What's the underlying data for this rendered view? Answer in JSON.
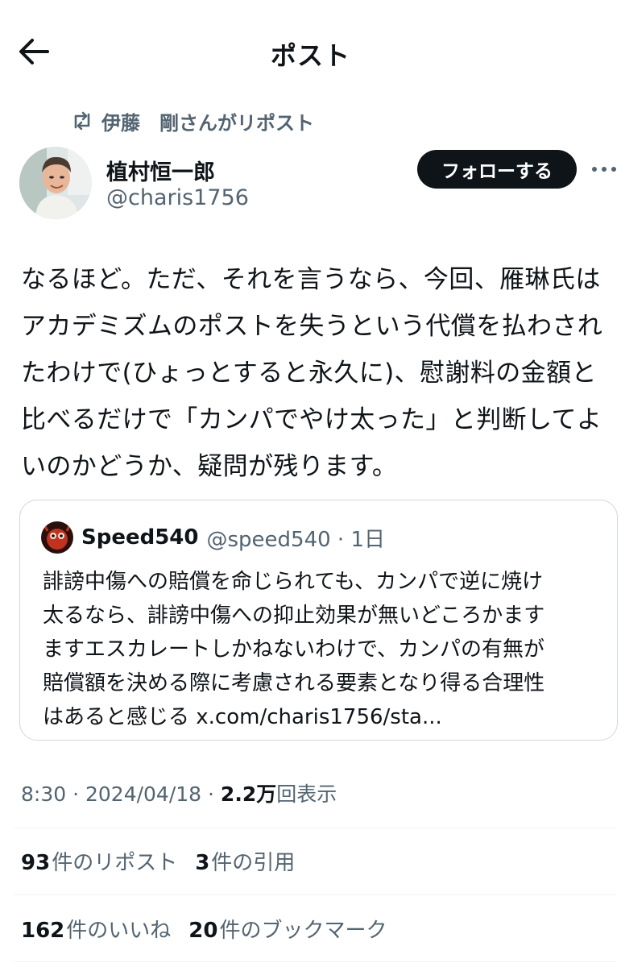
{
  "header": {
    "title": "ポスト",
    "back_icon": "arrow-left-icon"
  },
  "repost": {
    "icon": "repost-icon",
    "text": "伊藤　剛さんがリポスト"
  },
  "author": {
    "name": "植村恒一郎",
    "handle": "@charis1756",
    "follow_label": "フォローする",
    "more_icon": "more-icon"
  },
  "post": {
    "text": "なるほど。ただ、それを言うなら、今回、雁琳氏は\nアカデミズムのポストを失うという代償を払わされ\nたわけで(ひょっとすると永久に)、慰謝料の金額と\n比べるだけで「カンパでやけ太った」と判断してよ\nいのかどうか、疑問が残ります。"
  },
  "quote": {
    "name": "Speed540",
    "handle_time": "@speed540 · 1日",
    "text": "誹謗中傷への賠償を命じられても、カンパで逆に焼け\n太るなら、誹謗中傷への抑止効果が無いどころかます\nますエスカレートしかねないわけで、カンパの有無が\n賠償額を決める際に考慮される要素となり得る合理性\nはあると感じる x.com/charis1756/sta..."
  },
  "meta": {
    "time_date": "8:30 · 2024/04/18 · ",
    "views_count": "2.2万",
    "views_label": "回表示"
  },
  "stats": {
    "reposts_count": "93",
    "reposts_label": "件のリポスト",
    "quotes_count": "3",
    "quotes_label": "件の引用",
    "likes_count": "162",
    "likes_label": "件のいいね",
    "bookmarks_count": "20",
    "bookmarks_label": "件のブックマーク"
  },
  "colors": {
    "text_primary": "#0f1419",
    "text_secondary": "#536471",
    "border": "#cfd9de",
    "button_bg": "#0f1419"
  }
}
